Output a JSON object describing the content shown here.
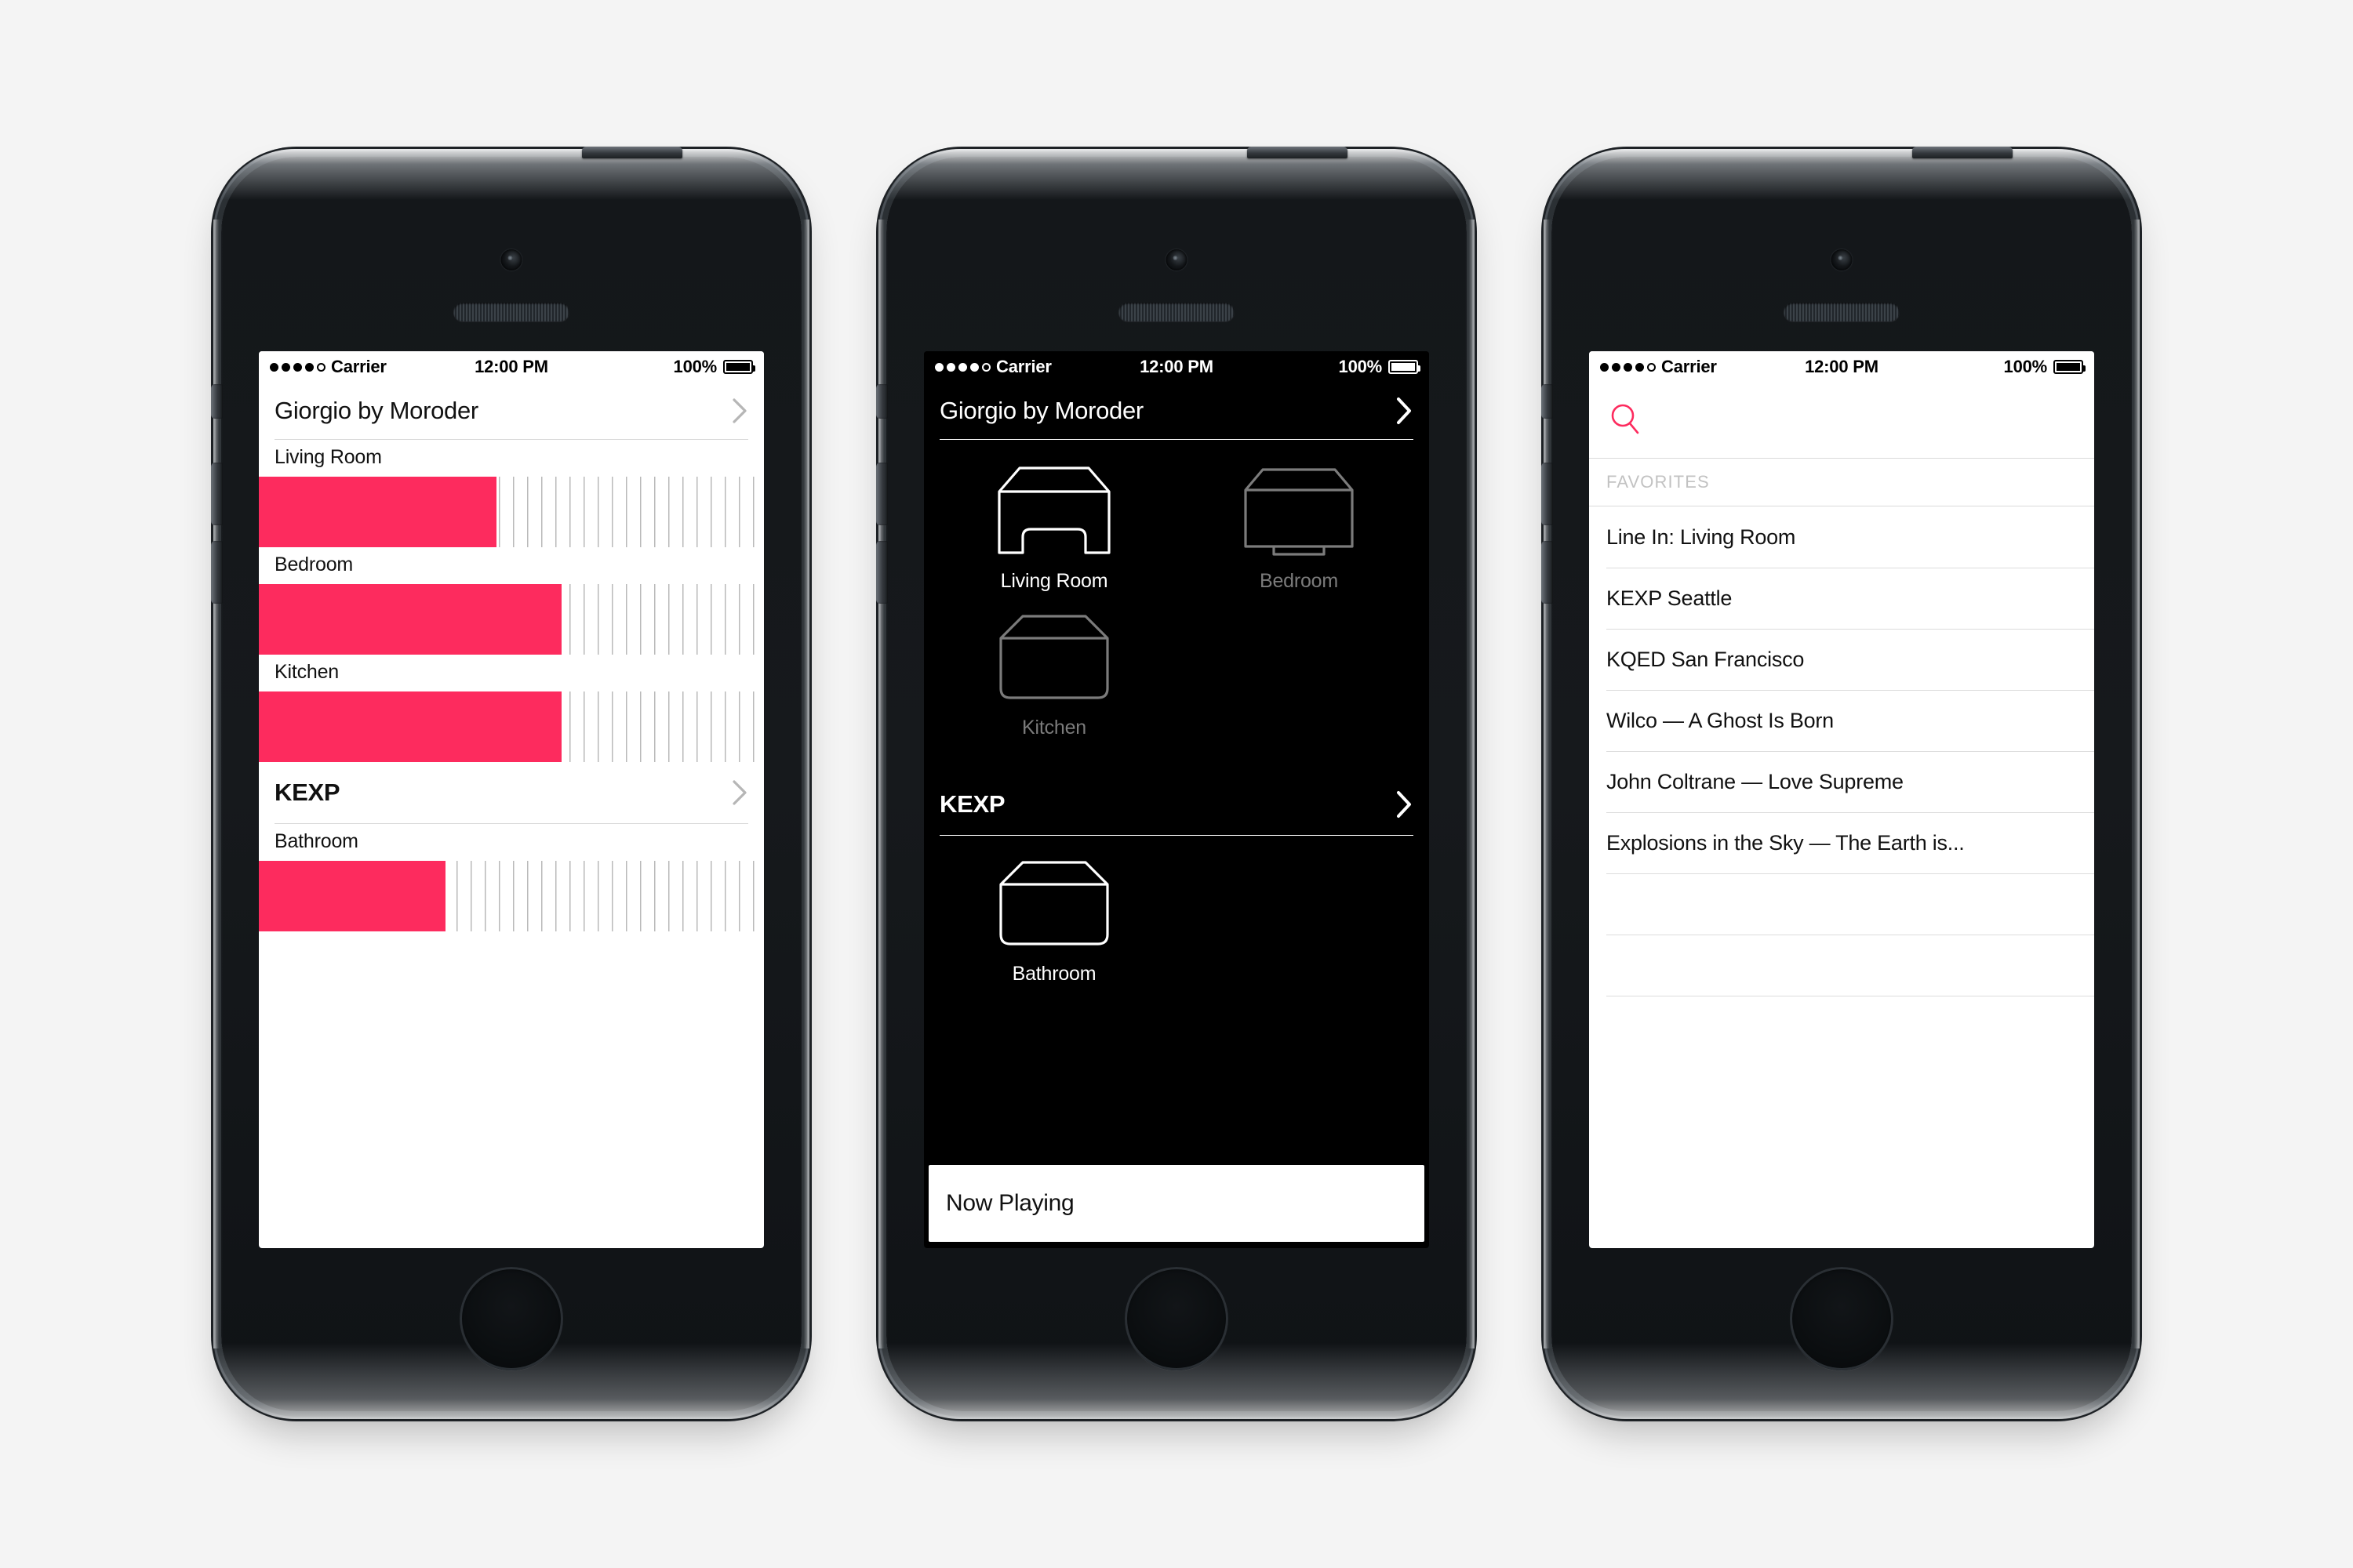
{
  "statusbar": {
    "carrier": "Carrier",
    "time": "12:00 PM",
    "battery_percent": "100%",
    "signal_filled": 4,
    "signal_empty": 1
  },
  "colors": {
    "accent_pink": "#fd2b5e",
    "light_bg": "#ffffff",
    "dark_bg": "#000000",
    "hairline": "#d9d9d9",
    "tick": "#b9b9b9",
    "muted_text": "#7b7b7b",
    "section_header_text": "#c2c2c2"
  },
  "phone1": {
    "now_playing_title": "Giorgio by Moroder",
    "chevron_icon": "chevron-right-icon",
    "volumes": [
      {
        "room": "Living Room",
        "level": 47
      },
      {
        "room": "Bedroom",
        "level": 60
      },
      {
        "room": "Kitchen",
        "level": 60
      },
      {
        "room": "Bathroom",
        "level": 37
      }
    ],
    "section": {
      "label": "KEXP",
      "chevron_icon": "chevron-right-icon"
    }
  },
  "phone2": {
    "now_playing_title": "Giorgio by Moroder",
    "chevron_icon": "chevron-right-icon",
    "group_a": {
      "speakers": [
        {
          "name": "Living Room",
          "state": "active",
          "shape": "play5"
        },
        {
          "name": "Bedroom",
          "state": "idle",
          "shape": "connect-amp"
        },
        {
          "name": "Kitchen",
          "state": "idle",
          "shape": "play1"
        }
      ]
    },
    "group_b": {
      "label": "KEXP",
      "chevron_icon": "chevron-right-icon",
      "speakers": [
        {
          "name": "Bathroom",
          "state": "active",
          "shape": "play1"
        }
      ]
    },
    "now_playing_bar": "Now Playing"
  },
  "phone3": {
    "search": {
      "icon": "search-icon",
      "placeholder": ""
    },
    "favorites_header": "FAVORITES",
    "favorites": [
      "Line In: Living Room",
      "KEXP Seattle",
      "KQED San Francisco",
      "Wilco — A Ghost Is Born",
      "John Coltrane — Love Supreme",
      "Explosions in the Sky — The Earth is...",
      "",
      "",
      ""
    ]
  }
}
